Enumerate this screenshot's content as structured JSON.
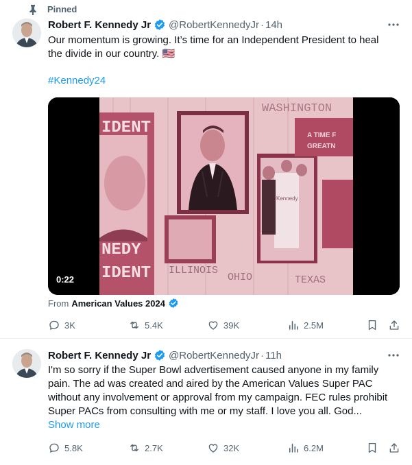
{
  "tweets": [
    {
      "pinned_label": "Pinned",
      "author_name": "Robert F. Kennedy Jr",
      "handle": "@RobertKennedyJr",
      "separator": "·",
      "time": "14h",
      "text_line1": "Our momentum is growing. It’s time for an Independent President to heal",
      "text_line2": "the divide in our country. 🇺🇸",
      "hashtag": "#Kennedy24",
      "video": {
        "duration": "0:22",
        "from_label": "From",
        "from_account": "American Values 2024",
        "poster_text": {
          "washington": "WASHINGTON",
          "ident_top": "IDENT",
          "nedy": "NEDY",
          "ident_bottom": "IDENT",
          "time_for": "A TIME F",
          "greatness": "GREATN",
          "illinois": "ILLINOIS",
          "ohio": "OHIO",
          "texas": "TEXAS",
          "kennedy": "Kennedy"
        }
      },
      "stats": {
        "replies": "3K",
        "reposts": "5.4K",
        "likes": "39K",
        "views": "2.5M"
      }
    },
    {
      "author_name": "Robert F. Kennedy Jr",
      "handle": "@RobertKennedyJr",
      "separator": "·",
      "time": "11h",
      "text_lines": [
        "I'm so sorry if the Super Bowl advertisement caused anyone in my family",
        "pain. The ad was created and aired by the American Values Super PAC",
        "without any involvement or approval from my campaign. FEC rules prohibit",
        "Super PACs from consulting with me or my staff. I love you all. God..."
      ],
      "show_more": "Show more",
      "stats": {
        "replies": "5.8K",
        "reposts": "2.7K",
        "likes": "32K",
        "views": "6.2M"
      }
    }
  ],
  "colors": {
    "accent": "#1d9bf0",
    "text": "#0f1419",
    "muted": "#536471",
    "video_pink": "#e8a6b4"
  },
  "icons": [
    "pin-icon",
    "verified-badge-icon",
    "more-icon",
    "reply-icon",
    "repost-icon",
    "like-icon",
    "views-icon",
    "bookmark-icon",
    "share-icon"
  ]
}
